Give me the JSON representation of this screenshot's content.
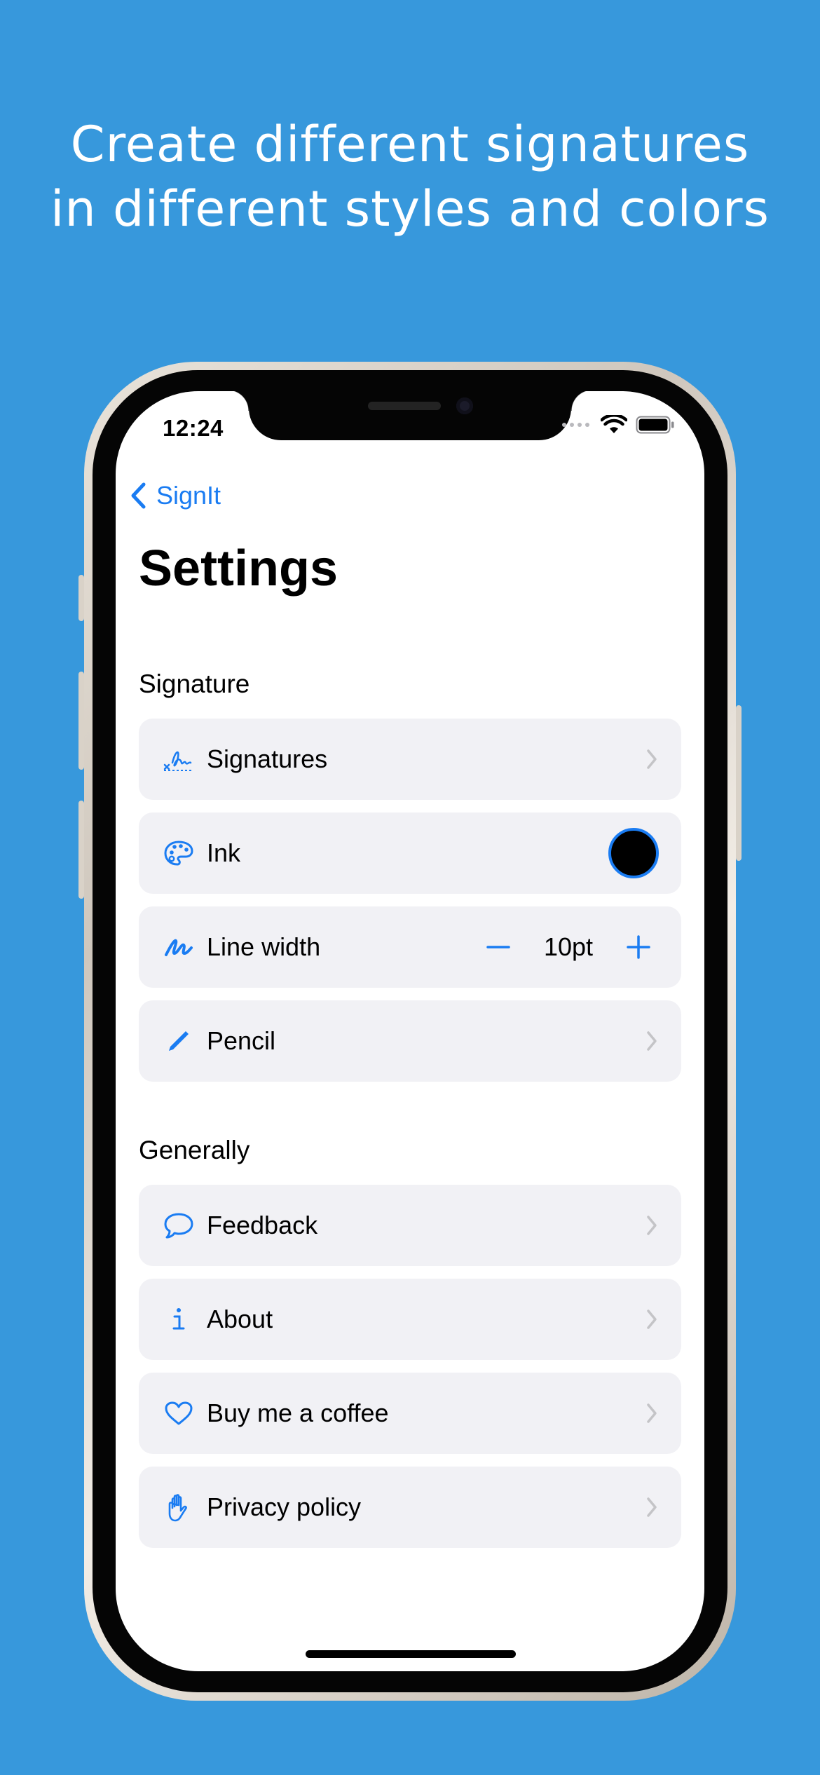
{
  "headline": {
    "line1": "Create different signatures",
    "line2": "in different styles and colors"
  },
  "colors": {
    "background": "#3798DC",
    "accent": "#1a7cf2",
    "row_background": "#f1f1f5",
    "ink_color": "#000000"
  },
  "status_bar": {
    "time": "12:24",
    "icons": [
      "signal-dots-icon",
      "wifi-icon",
      "battery-icon"
    ]
  },
  "nav": {
    "back_label": "SignIt",
    "title": "Settings"
  },
  "sections": [
    {
      "label": "Signature",
      "items": [
        {
          "label": "Signatures",
          "icon": "signature-icon",
          "accessory": "chevron"
        },
        {
          "label": "Ink",
          "icon": "palette-icon",
          "accessory": "color-swatch"
        },
        {
          "label": "Line width",
          "icon": "scribble-icon",
          "accessory": "stepper",
          "value": "10pt"
        },
        {
          "label": "Pencil",
          "icon": "pencil-icon",
          "accessory": "chevron"
        }
      ]
    },
    {
      "label": "Generally",
      "items": [
        {
          "label": "Feedback",
          "icon": "speech-bubble-icon",
          "accessory": "chevron"
        },
        {
          "label": "About",
          "icon": "info-icon",
          "accessory": "chevron"
        },
        {
          "label": "Buy me a coffee",
          "icon": "heart-icon",
          "accessory": "chevron"
        },
        {
          "label": "Privacy policy",
          "icon": "hand-raised-icon",
          "accessory": "chevron"
        }
      ]
    }
  ]
}
